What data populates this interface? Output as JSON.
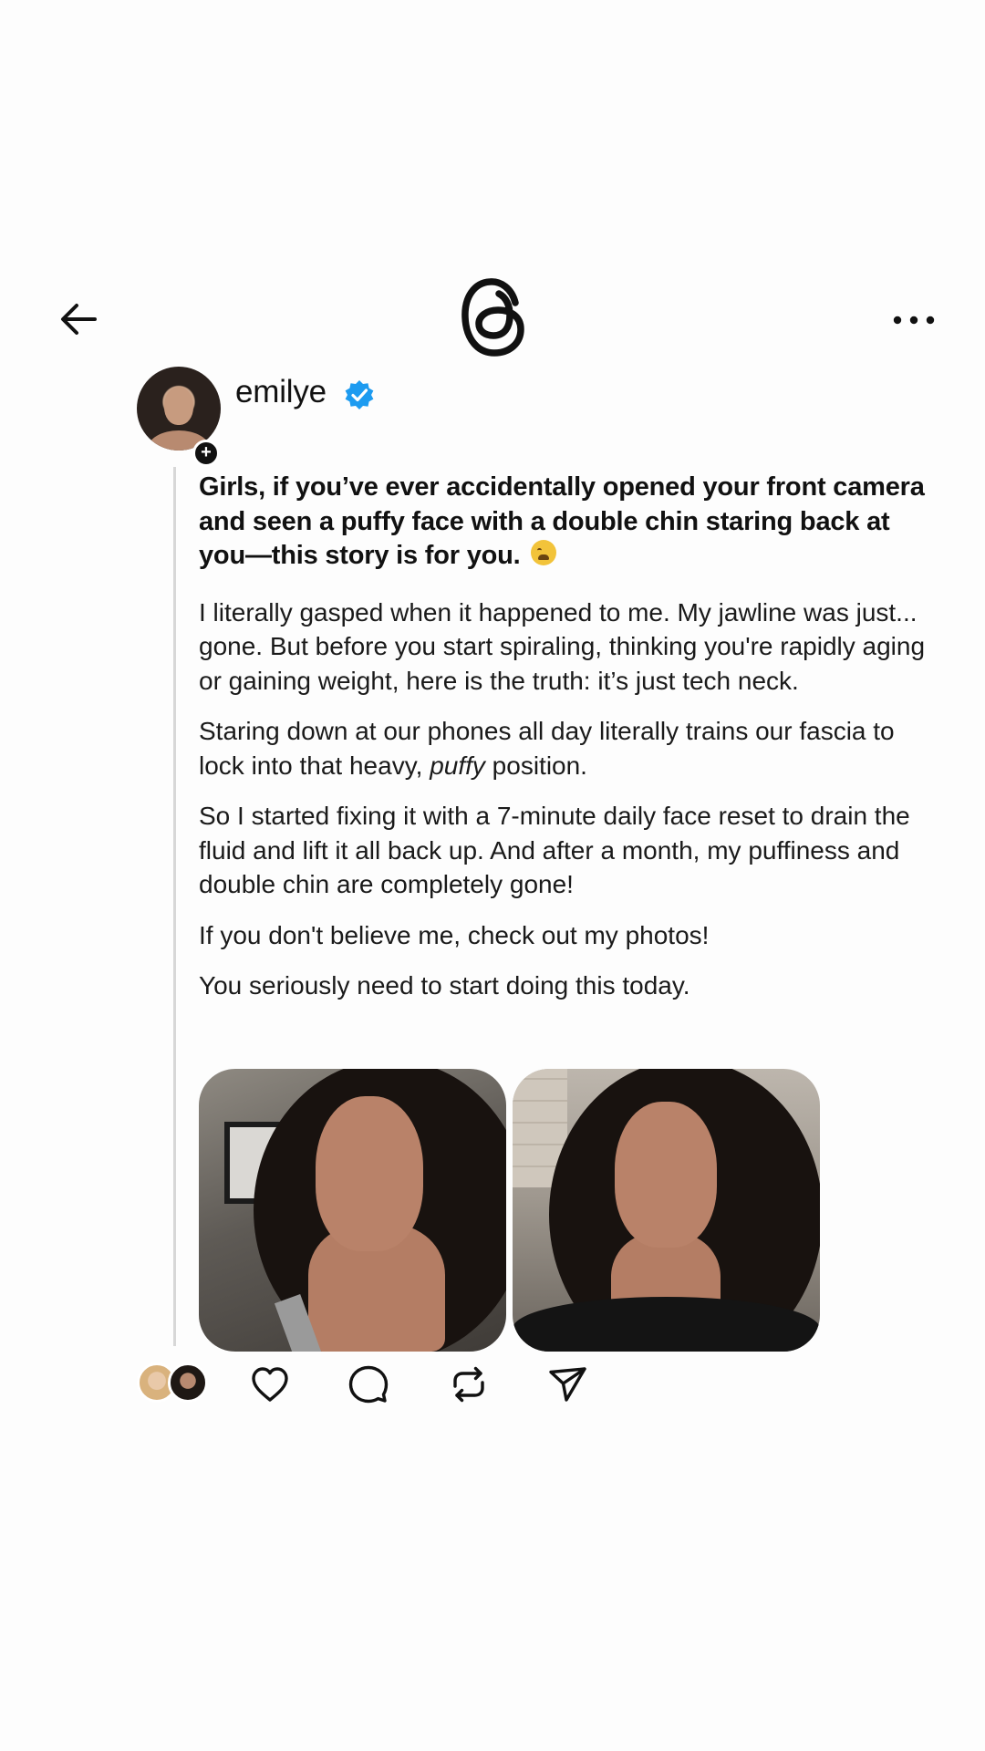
{
  "header": {
    "back_icon": "arrow-left-icon",
    "logo_icon": "threads-logo-icon",
    "more_icon": "more-horizontal-icon"
  },
  "author": {
    "username": "emilye",
    "verified": true,
    "follow_glyph": "+"
  },
  "post": {
    "headline": "Girls, if you’ve ever accidentally opened your front camera and seen a puffy face with a double chin staring back at you—this story is for you.",
    "emoji": "😩",
    "paragraphs": [
      "I literally gasped when it happened to me. My jawline was just... gone. But before you start spiraling, thinking you're rapidly aging or gaining weight, here is the truth: it’s just tech neck.",
      "Staring down at our phones all day literally trains our fascia to lock into that heavy,",
      "So I started fixing it with a 7-minute daily face reset to drain the fluid and lift it all back up. And after a month, my puffiness and double chin are completely gone!",
      "If you don't believe me, check out my photos!",
      "You seriously need to start doing this today."
    ],
    "para2_italic": "puffy",
    "para2_end": " position."
  },
  "actions": {
    "like_icon": "heart-icon",
    "reply_icon": "comment-icon",
    "repost_icon": "repost-icon",
    "share_icon": "send-icon"
  },
  "colors": {
    "background": "#fdfdfd",
    "text": "#111111",
    "verified_blue": "#1d9bf0",
    "thread_line": "#d7d7d7"
  }
}
